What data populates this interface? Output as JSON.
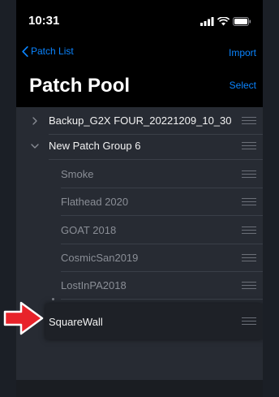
{
  "status_bar": {
    "time": "10:31"
  },
  "nav": {
    "back_label": "Patch List",
    "import_label": "Import",
    "title": "Patch Pool",
    "select_label": "Select"
  },
  "groups": [
    {
      "label": "Backup_G2X FOUR_20221209_10_30",
      "expanded": false
    },
    {
      "label": "New Patch Group 6",
      "expanded": true
    }
  ],
  "patches": [
    {
      "label": "Smoke"
    },
    {
      "label": "Flathead 2020"
    },
    {
      "label": "GOAT 2018"
    },
    {
      "label": "CosmicSan2019"
    },
    {
      "label": "LostInPA2018"
    }
  ],
  "dragging_patch": {
    "label": "SquareWall"
  },
  "colors": {
    "accent": "#0a84ff",
    "arrow": "#e8232a",
    "list_background": "#272b33"
  },
  "icons": {
    "back": "chevron-left-icon",
    "collapsed": "chevron-right-icon",
    "expanded": "chevron-down-icon",
    "reorder": "reorder-handle-icon",
    "annotation": "red-arrow-icon"
  }
}
